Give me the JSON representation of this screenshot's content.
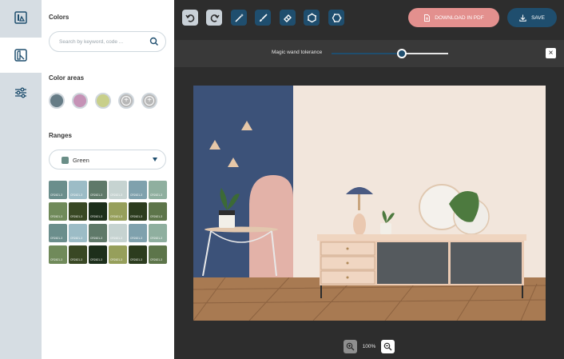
{
  "sidebar": {
    "items": [
      {
        "name": "gallery-icon",
        "active": false
      },
      {
        "name": "color-palette-icon",
        "active": true
      },
      {
        "name": "sliders-icon",
        "active": false
      }
    ]
  },
  "panel": {
    "colors_title": "Colors",
    "search_placeholder": "Search by keyword, code ...",
    "color_areas_title": "Color areas",
    "color_areas": [
      "#667c86",
      "#c592b6",
      "#c8cf8a",
      "add",
      "add"
    ],
    "ranges_title": "Ranges",
    "range_selected": {
      "label": "Green",
      "color": "#6a8e87"
    },
    "palette": [
      [
        {
          "color": "#6b8e8c",
          "label": "CR2421-3"
        },
        {
          "color": "#9cbcc6",
          "label": "CR2421-3"
        },
        {
          "color": "#5f7969",
          "label": "CR2421-3"
        },
        {
          "color": "#c6d3d1",
          "label": "CR2421-3"
        },
        {
          "color": "#7fa1ad",
          "label": "CR2421-3"
        },
        {
          "color": "#8faf9f",
          "label": "CR2421-3"
        }
      ],
      [
        {
          "color": "#708a5a",
          "label": "CR2421-3"
        },
        {
          "color": "#394824",
          "label": "CR2421-3"
        },
        {
          "color": "#1d2f1b",
          "label": "CR2421-3"
        },
        {
          "color": "#969f5b",
          "label": "CR2421-3"
        },
        {
          "color": "#2c3c1e",
          "label": "CR2421-3"
        },
        {
          "color": "#5d754a",
          "label": "CR2421-3"
        }
      ],
      [
        {
          "color": "#6b8e8c",
          "label": "CR2421-3"
        },
        {
          "color": "#9cbcc6",
          "label": "CR2421-3"
        },
        {
          "color": "#5f7969",
          "label": "CR2421-3"
        },
        {
          "color": "#c6d3d1",
          "label": "CR2421-3"
        },
        {
          "color": "#7fa1ad",
          "label": "CR2421-3"
        },
        {
          "color": "#8faf9f",
          "label": "CR2421-3"
        }
      ],
      [
        {
          "color": "#708a5a",
          "label": "CR2421-3"
        },
        {
          "color": "#394824",
          "label": "CR2421-3"
        },
        {
          "color": "#1d2f1b",
          "label": "CR2421-3"
        },
        {
          "color": "#969f5b",
          "label": "CR2421-3"
        },
        {
          "color": "#2c3c1e",
          "label": "CR2421-3"
        },
        {
          "color": "#5d754a",
          "label": "CR2421-3"
        }
      ]
    ]
  },
  "toolbar": {
    "tools": [
      "undo-icon",
      "redo-icon",
      "magic-wand-icon",
      "brush-icon",
      "eraser-icon",
      "polygon-select-icon",
      "polygon-select-alt-icon"
    ],
    "download_label": "DOWNLOAD IN PDF",
    "save_label": "SAVE"
  },
  "tolerance": {
    "label": "Magic wand tolerance",
    "value": 0.6
  },
  "zoom": {
    "level": "100%"
  },
  "colors": {
    "accent": "#1f4e6e",
    "pdf_button": "#e3908e",
    "background": "#2d2d2d"
  }
}
